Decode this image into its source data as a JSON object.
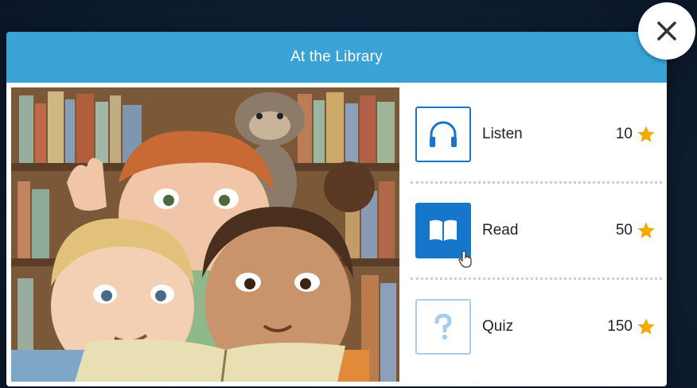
{
  "modal": {
    "title": "At the Library"
  },
  "close_button": {
    "icon": "close-icon"
  },
  "activities": [
    {
      "label": "Listen",
      "points": "10",
      "icon": "headphones-icon",
      "state": "outline"
    },
    {
      "label": "Read",
      "points": "50",
      "icon": "book-icon",
      "state": "active"
    },
    {
      "label": "Quiz",
      "points": "150",
      "icon": "question-icon",
      "state": "disabled"
    }
  ],
  "colors": {
    "header": "#3aa3d6",
    "accent": "#1676c9",
    "accent_light": "#a9cdeb",
    "star": "#f2a900"
  }
}
